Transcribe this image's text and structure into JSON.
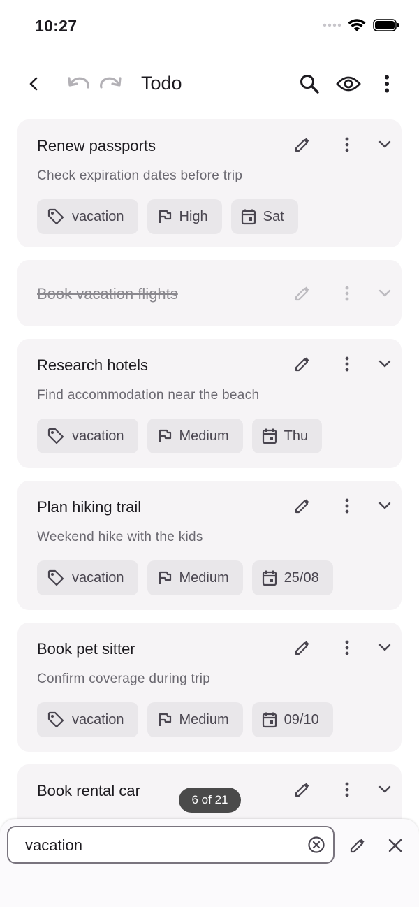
{
  "status_bar": {
    "time": "10:27"
  },
  "app_bar": {
    "title": "Todo"
  },
  "tasks": [
    {
      "title": "Renew passports",
      "description": "Check expiration dates before trip",
      "tag": "vacation",
      "priority": "High",
      "due": "Sat",
      "completed": false
    },
    {
      "title": "Book vacation flights",
      "completed": true
    },
    {
      "title": "Research hotels",
      "description": "Find accommodation near the beach",
      "tag": "vacation",
      "priority": "Medium",
      "due": "Thu",
      "completed": false
    },
    {
      "title": "Plan hiking trail",
      "description": "Weekend hike with the kids",
      "tag": "vacation",
      "priority": "Medium",
      "due": "25/08",
      "completed": false
    },
    {
      "title": "Book pet sitter",
      "description": "Confirm coverage during trip",
      "tag": "vacation",
      "priority": "Medium",
      "due": "09/10",
      "completed": false
    },
    {
      "title": "Book rental car",
      "completed": false
    }
  ],
  "search": {
    "result_counter": "6 of 21",
    "query": "vacation"
  },
  "colors": {
    "card_bg": "#f6f4f6",
    "chip_bg": "#e9e7ea",
    "badge_bg": "#4a4a4a"
  },
  "icons": [
    "back-arrow-icon",
    "undo-icon",
    "redo-icon",
    "search-icon",
    "eye-icon",
    "more-vert-icon",
    "edit-icon",
    "chevron-down-icon",
    "tag-icon",
    "flag-icon",
    "calendar-icon",
    "clear-circle-icon",
    "close-icon",
    "wifi-icon",
    "battery-icon",
    "signal-icon"
  ]
}
